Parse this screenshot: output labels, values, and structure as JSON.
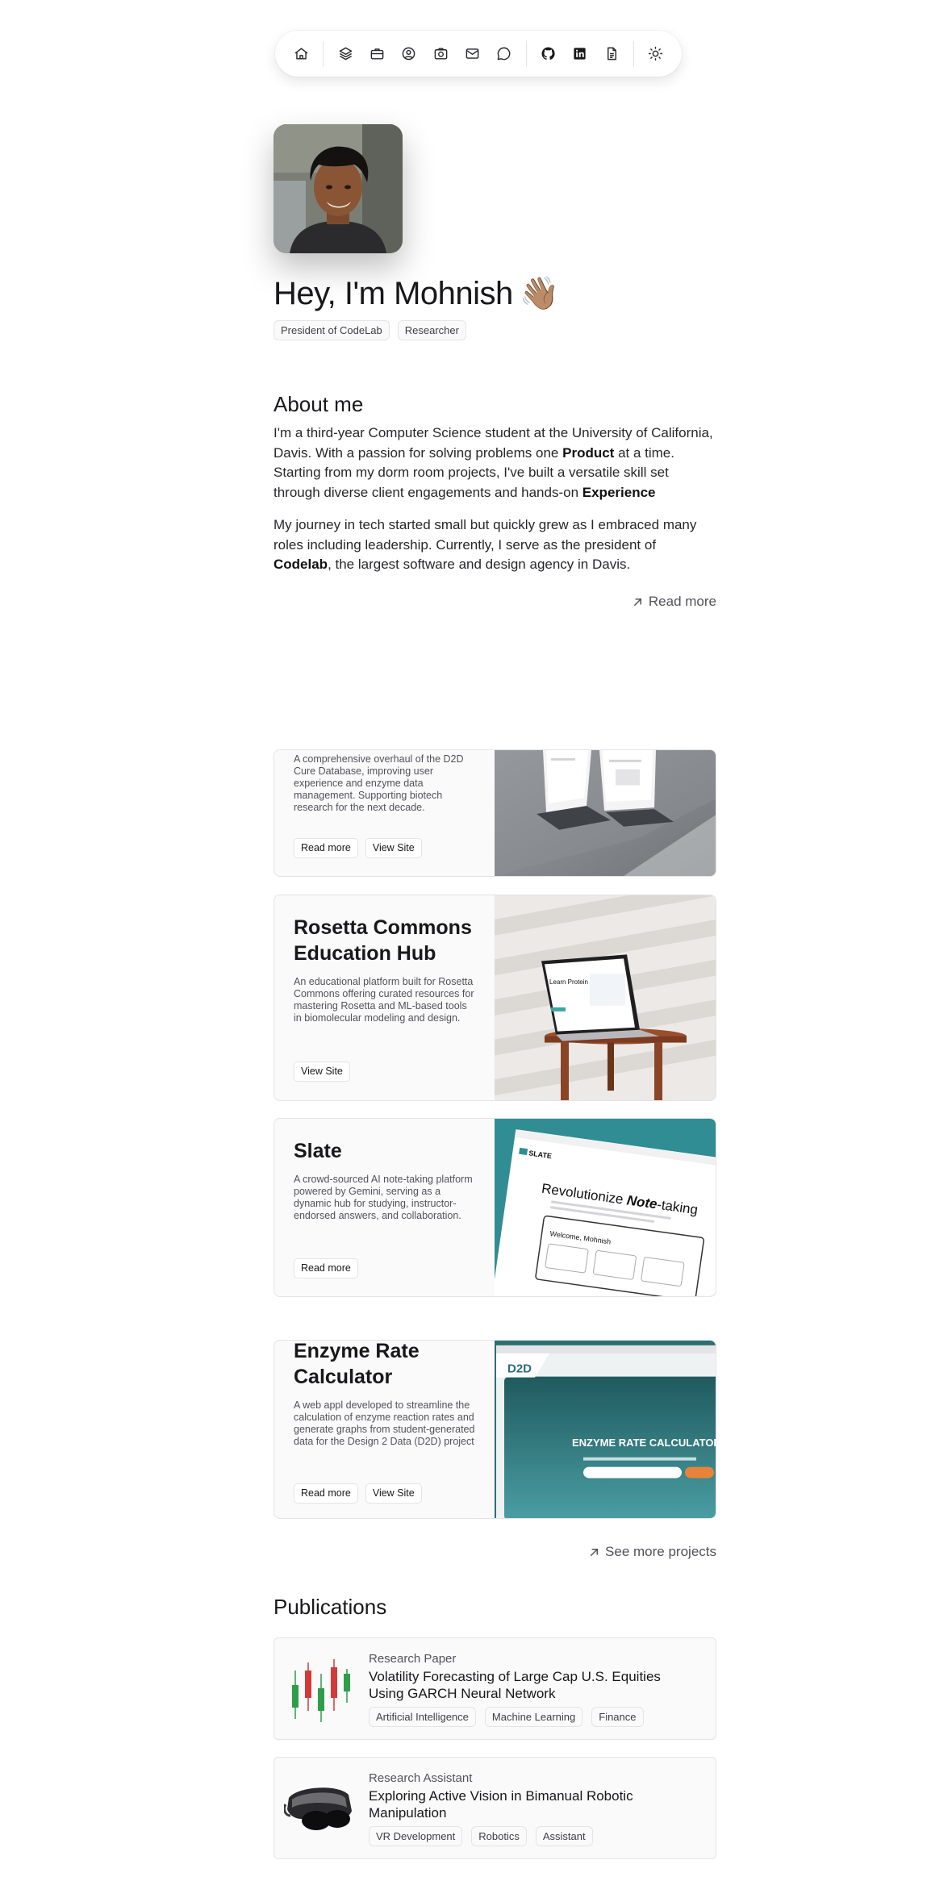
{
  "nav": {
    "icons": [
      "home-icon",
      "layers-icon",
      "briefcase-icon",
      "user-circle-icon",
      "camera-icon",
      "mail-icon",
      "chat-icon",
      "github-icon",
      "linkedin-icon",
      "document-icon",
      "sun-icon"
    ]
  },
  "hero": {
    "greeting": "Hey, I'm Mohnish",
    "wave": "👋🏽",
    "tags": [
      "President of CodeLab",
      "Researcher"
    ]
  },
  "about": {
    "title": "About me",
    "p1_a": "I'm a third-year Computer Science student at the University of California, Davis. With a passion for solving problems one ",
    "p1_b": "Product",
    "p1_c": " at a time. Starting from my dorm room projects, I've built a versatile skill set through diverse client engagements and hands-on ",
    "p1_d": "Experience",
    "p2_a": "My journey in tech started small but quickly grew as I embraced many roles including leadership. Currently, I serve as the president of ",
    "p2_b": "Codelab",
    "p2_c": ", the largest software and design agency in Davis.",
    "read_more": "Read more"
  },
  "projects": [
    {
      "title": "",
      "description": "A comprehensive overhaul of the D2D Cure Database, improving user experience and enzyme data management. Supporting biotech research for the next decade.",
      "buttons": [
        "Read more",
        "View Site"
      ]
    },
    {
      "title": "Rosetta Commons Education Hub",
      "description": "An educational platform built for Rosetta Commons offering curated resources for mastering Rosetta and ML-based tools in biomolecular modeling and design.",
      "buttons": [
        "View Site"
      ],
      "screen_text": "Learn Protein Modeling"
    },
    {
      "title": "Slate",
      "description": "A crowd-sourced AI note-taking platform powered by Gemini, serving as a dynamic hub for studying, instructor-endorsed answers, and collaboration.",
      "buttons": [
        "Read more"
      ],
      "brand": "SLATE",
      "headline_a": "Revolutionize ",
      "headline_b": "Note",
      "headline_c": "-taking",
      "welcome": "Welcome, Mohnish"
    },
    {
      "title": "Enzyme Rate Calculator",
      "description": "A web appl developed to streamline the calculation of enzyme reaction rates and generate graphs from student-generated data for the Design 2 Data (D2D) project",
      "buttons": [
        "Read more",
        "View Site"
      ],
      "screen_title": "ENZYME RATE CALCULATOR",
      "screen_logo": "D2D"
    }
  ],
  "see_more": "See more projects",
  "publications": {
    "title": "Publications",
    "items": [
      {
        "type": "Research Paper",
        "title": "Volatility Forecasting of Large Cap U.S. Equities Using GARCH Neural Network",
        "tags": [
          "Artificial Intelligence",
          "Machine Learning",
          "Finance"
        ]
      },
      {
        "type": "Research Assistant",
        "title": "Exploring Active Vision in Bimanual Robotic Manipulation",
        "tags": [
          "VR Development",
          "Robotics",
          "Assistant"
        ]
      }
    ]
  }
}
